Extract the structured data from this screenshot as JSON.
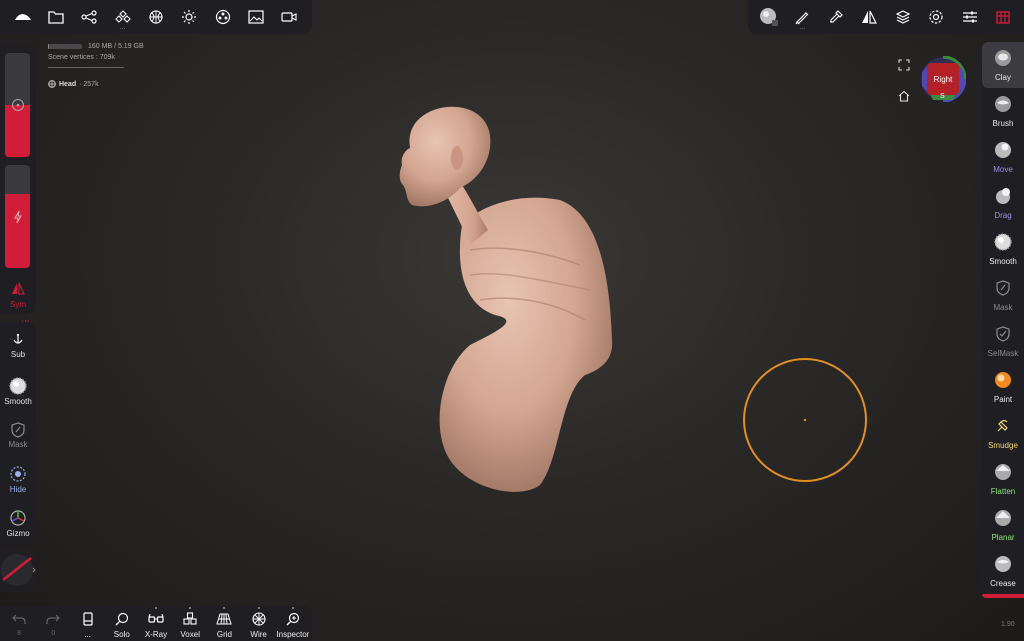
{
  "top_left_toolbar": [
    {
      "name": "logo-icon"
    },
    {
      "name": "folder-icon"
    },
    {
      "name": "scene-graph-icon"
    },
    {
      "name": "primitives-icon"
    },
    {
      "name": "topology-icon"
    },
    {
      "name": "light-icon"
    },
    {
      "name": "material-icon"
    },
    {
      "name": "image-icon"
    },
    {
      "name": "video-icon"
    }
  ],
  "top_right_toolbar": [
    {
      "name": "brush-sphere-icon"
    },
    {
      "name": "stroke-icon"
    },
    {
      "name": "picker-icon"
    },
    {
      "name": "symmetry-icon"
    },
    {
      "name": "layers-icon"
    },
    {
      "name": "settings-icon"
    },
    {
      "name": "sliders-icon"
    },
    {
      "name": "bookmark-icon"
    }
  ],
  "info": {
    "memory": "160 MB / 5.19 GB",
    "memory_fraction": 0.031,
    "scene_vertices": "Scene vertices : 709k",
    "mesh_name": "Head",
    "mesh_count": "· 257k"
  },
  "left_panel": {
    "radius_fraction": 0.5,
    "intensity_fraction": 0.72,
    "sym_label": "Sym",
    "sym_badge": "LM"
  },
  "left_tools": [
    {
      "label": "Sub",
      "icon": "anchor-icon",
      "color": "#e0e0e0"
    },
    {
      "label": "Smooth",
      "icon": "smooth-sphere-icon",
      "color": "#e0e0e0"
    },
    {
      "label": "Mask",
      "icon": "mask-icon",
      "color": "#8a8a8a"
    },
    {
      "label": "Hide",
      "icon": "hide-icon",
      "color": "#9ab0e8"
    },
    {
      "label": "Gizmo",
      "icon": "gizmo-icon",
      "color": "#e0e0e0"
    }
  ],
  "bottom_bar": [
    {
      "label": "",
      "icon": "undo-icon",
      "sub": "8"
    },
    {
      "label": "",
      "icon": "redo-icon",
      "sub": "0"
    },
    {
      "label": "...",
      "icon": "document-icon"
    },
    {
      "label": "Solo",
      "icon": "search-icon"
    },
    {
      "label": "X-Ray",
      "icon": "glasses-icon"
    },
    {
      "label": "Voxel",
      "icon": "voxel-icon"
    },
    {
      "label": "Grid",
      "icon": "grid-icon"
    },
    {
      "label": "Wire",
      "icon": "wire-icon"
    },
    {
      "label": "Inspector",
      "icon": "inspector-icon"
    }
  ],
  "right_tools": [
    {
      "label": "Clay",
      "icon": "clay-icon",
      "color": "#e8e8e8",
      "active": true
    },
    {
      "label": "Brush",
      "icon": "brush-icon",
      "color": "#e8e8e8"
    },
    {
      "label": "Move",
      "icon": "move-icon",
      "color": "#9a8ee8"
    },
    {
      "label": "Drag",
      "icon": "drag-icon",
      "color": "#9a8ee8"
    },
    {
      "label": "Smooth",
      "icon": "smooth-icon",
      "color": "#e8e8e8"
    },
    {
      "label": "Mask",
      "icon": "mask-icon",
      "color": "#8a8a8a"
    },
    {
      "label": "SelMask",
      "icon": "selmask-icon",
      "color": "#8a8a8a"
    },
    {
      "label": "Paint",
      "icon": "paint-icon",
      "color": "#e8e8e8"
    },
    {
      "label": "Smudge",
      "icon": "smudge-icon",
      "color": "#f0d86a"
    },
    {
      "label": "Flatten",
      "icon": "flatten-icon",
      "color": "#8ee07a"
    },
    {
      "label": "Planar",
      "icon": "planar-icon",
      "color": "#8ee07a"
    },
    {
      "label": "Crease",
      "icon": "crease-icon",
      "color": "#e8e8e8"
    }
  ],
  "view_cube": {
    "face": "Right",
    "bottom": "S"
  },
  "version": "1.90",
  "colors": {
    "accent": "#d21d3a",
    "cursor": "#e0901e",
    "model": "#d8aa94"
  }
}
